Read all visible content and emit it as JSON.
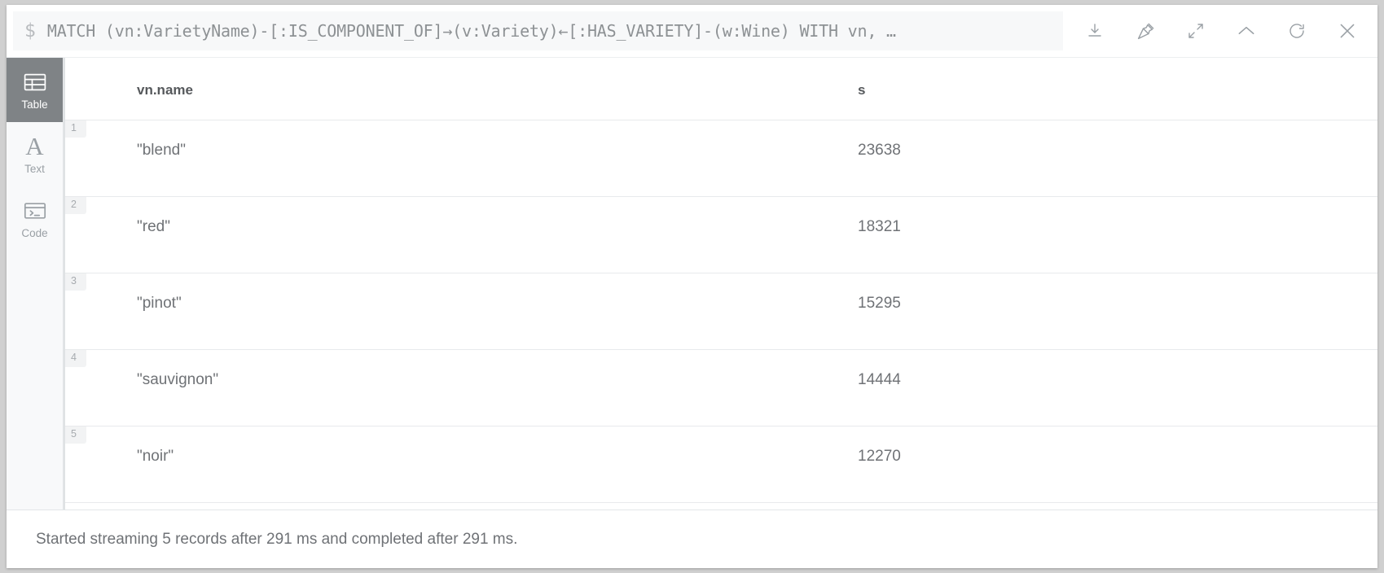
{
  "query": {
    "prompt": "$",
    "text": "MATCH (vn:VarietyName)-[:IS_COMPONENT_OF]→(v:Variety)←[:HAS_VARIETY]-(w:Wine) WITH vn, …"
  },
  "toolbar": {
    "icons": [
      {
        "name": "download-icon",
        "title": "Download"
      },
      {
        "name": "pin-icon",
        "title": "Pin"
      },
      {
        "name": "expand-icon",
        "title": "Expand"
      },
      {
        "name": "collapse-chevron-up-icon",
        "title": "Collapse"
      },
      {
        "name": "refresh-icon",
        "title": "Rerun"
      },
      {
        "name": "close-icon",
        "title": "Close"
      }
    ]
  },
  "sidebar": {
    "items": [
      {
        "label": "Table",
        "icon": "table-icon",
        "active": true
      },
      {
        "label": "Text",
        "icon": "text-icon",
        "active": false
      },
      {
        "label": "Code",
        "icon": "code-icon",
        "active": false
      }
    ]
  },
  "table": {
    "columns": [
      "vn.name",
      "s"
    ],
    "rows": [
      {
        "num": "1",
        "name": "\"blend\"",
        "s": "23638"
      },
      {
        "num": "2",
        "name": "\"red\"",
        "s": "18321"
      },
      {
        "num": "3",
        "name": "\"pinot\"",
        "s": "15295"
      },
      {
        "num": "4",
        "name": "\"sauvignon\"",
        "s": "14444"
      },
      {
        "num": "5",
        "name": "\"noir\"",
        "s": "12270"
      }
    ]
  },
  "status": {
    "message": "Started streaming 5 records after 291 ms and completed after 291 ms."
  },
  "colors": {
    "active_sidebar": "#7f8386",
    "text_muted": "#6f7276",
    "query_bg": "#f7f8f9",
    "border": "#e8eaec"
  }
}
